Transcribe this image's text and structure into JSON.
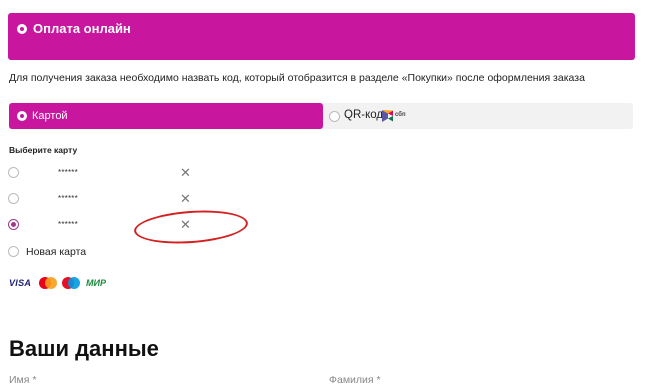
{
  "payment": {
    "title": "Оплата онлайн",
    "info": "Для получения заказа необходимо назвать код, который отобразится в разделе «Покупки» после оформления заказа",
    "tabs": [
      {
        "label": "Картой",
        "selected": true
      },
      {
        "label": "QR-код",
        "selected": false,
        "logo_text": "сбп"
      }
    ],
    "choose_label": "Выберите карту",
    "cards": [
      {
        "mask": "******",
        "selected": false
      },
      {
        "mask": "******",
        "selected": false
      },
      {
        "mask": "******",
        "selected": true
      }
    ],
    "new_card_label": "Новая карта",
    "brands": [
      "VISA",
      "Mastercard",
      "Maestro",
      "МИР"
    ],
    "brand_text": {
      "visa": "VISA",
      "mir": "МИР"
    },
    "accent_color": "#c9169f"
  },
  "your_data": {
    "heading": "Ваши данные",
    "first_name_label": "Имя *",
    "last_name_label": "Фамилия *"
  }
}
